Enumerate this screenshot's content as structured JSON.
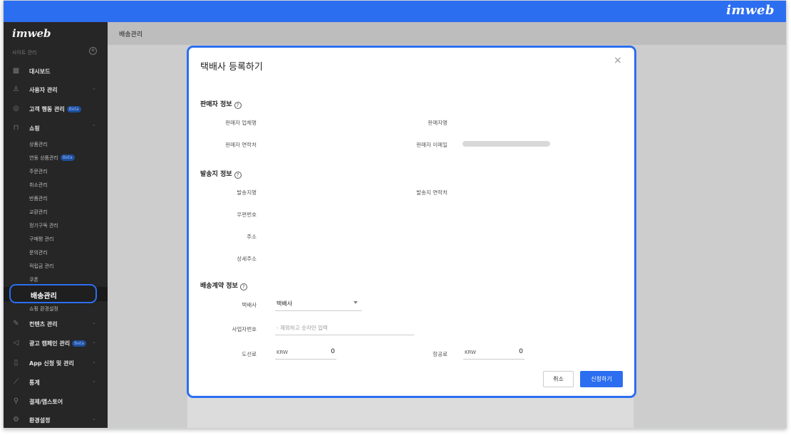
{
  "brand": "imweb",
  "sidebar": {
    "logo": "imweb",
    "site_label": "사이트 관리",
    "site_add": "+",
    "items": [
      {
        "icon": "dashboard-icon",
        "glyph": "▦",
        "label": "대시보드",
        "beta": "",
        "chevron": ""
      },
      {
        "icon": "user-icon",
        "glyph": "♙",
        "label": "사용자 관리",
        "beta": "",
        "chevron": "⌄"
      },
      {
        "icon": "target-icon",
        "glyph": "◎",
        "label": "고객 행동 관리",
        "beta": "Beta",
        "chevron": ""
      },
      {
        "icon": "shopping-bag-icon",
        "glyph": "⊓",
        "label": "쇼핑",
        "beta": "",
        "chevron": "⌃"
      }
    ],
    "shop_sub_items": [
      "상품관리",
      "연동 상품관리",
      "주문관리",
      "취소관리",
      "반품관리",
      "교환관리",
      "정기구독 관리",
      "구매평 관리",
      "문의관리",
      "적립금 관리",
      "쿠폰"
    ],
    "shop_sub_beta": "Beta",
    "active_item": "배송관리",
    "after_active": "쇼핑 환경설정",
    "bottom_items": [
      {
        "icon": "edit-icon",
        "glyph": "✎",
        "label": "컨텐츠 관리",
        "beta": "",
        "chevron": "⌄"
      },
      {
        "icon": "megaphone-icon",
        "glyph": "◁",
        "label": "광고 캠페인 관리",
        "beta": "Beta",
        "chevron": "⌄"
      },
      {
        "icon": "mobile-icon",
        "glyph": "▯",
        "label": "App 신청 및 관리",
        "beta": "",
        "chevron": "⌄"
      },
      {
        "icon": "chart-icon",
        "glyph": "⟋",
        "label": "통계",
        "beta": "",
        "chevron": "⌄"
      },
      {
        "icon": "rocket-icon",
        "glyph": "⚲",
        "label": "결제/앱스토어",
        "beta": "",
        "chevron": ""
      },
      {
        "icon": "gear-icon",
        "glyph": "⚙",
        "label": "환경설정",
        "beta": "",
        "chevron": "⌄"
      }
    ]
  },
  "header": {
    "title": "배송관리"
  },
  "modal": {
    "title": "택배사 등록하기",
    "close": "×",
    "help_glyph": "?",
    "seller_section": {
      "title": "판매자 정보",
      "company_label": "판매자 업체명",
      "name_label": "판매자명",
      "contact_label": "판매자 연락처",
      "email_label": "판매자 이메일"
    },
    "sender_section": {
      "title": "발송지 정보",
      "place_label": "발송지명",
      "contact_label": "발송지 연락처",
      "zip_label": "우편번호",
      "address_label": "주소",
      "detail_label": "상세주소"
    },
    "contract_section": {
      "title": "배송계약 정보",
      "courier_label": "택배사",
      "courier_value": "택배사",
      "biz_label": "사업자번호",
      "biz_placeholder": "- 제외하고 숫자만 입력",
      "island_label": "도선료",
      "island_currency": "KRW",
      "island_value": "0",
      "air_label": "항공료",
      "air_currency": "KRW",
      "air_value": "0"
    },
    "cancel": "취소",
    "submit": "신청하기"
  }
}
